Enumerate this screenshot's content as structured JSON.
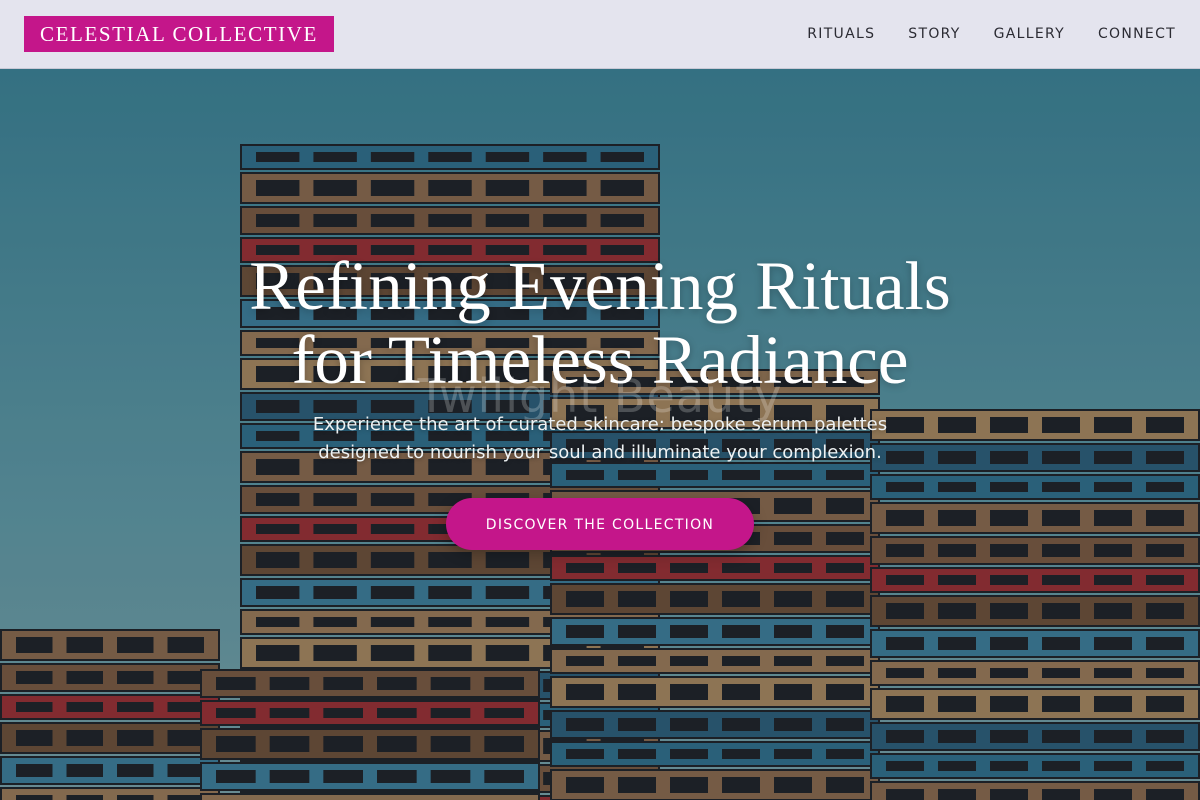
{
  "header": {
    "logo_text": "CELESTIAL COLLECTIVE",
    "nav": [
      "RITUALS",
      "STORY",
      "GALLERY",
      "CONNECT"
    ]
  },
  "hero": {
    "watermark": "Twilight Beauty",
    "title_line1": "Refining Evening Rituals",
    "title_line2": "for Timeless Radiance",
    "subtitle_line1": "Experience the art of curated skincare: bespoke serum palettes",
    "subtitle_line2": "designed to nourish your soul and illuminate your complexion.",
    "cta_label": "DISCOVER THE COLLECTION",
    "background_image": "stacked-wooden-pallets-photo"
  },
  "colors": {
    "accent": "#c4168a",
    "header_bg": "#e4e4ee",
    "nav_text": "#2b2b33",
    "sky": "#3f8597"
  }
}
